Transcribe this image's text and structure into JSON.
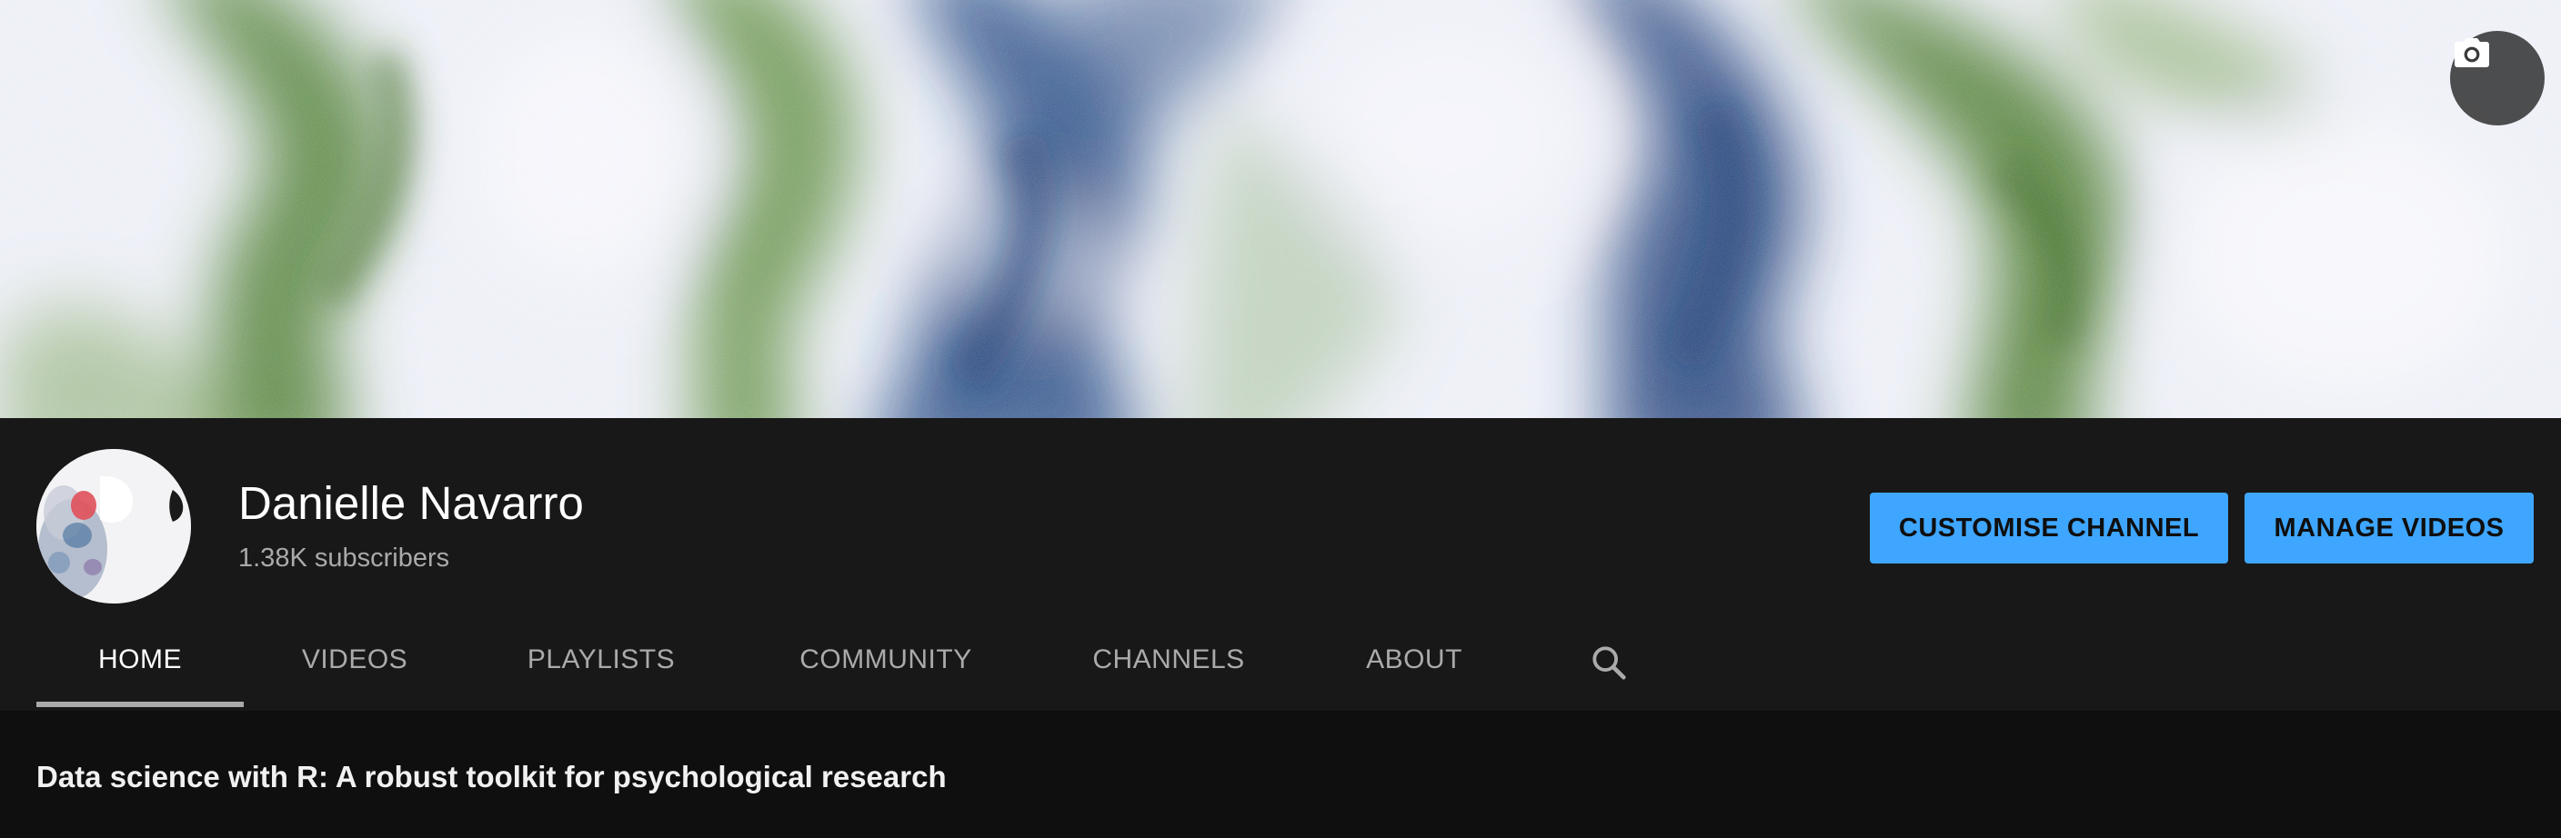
{
  "banner": {
    "camera_icon": "camera-icon"
  },
  "channel": {
    "name": "Danielle Navarro",
    "subscribers": "1.38K subscribers"
  },
  "actions": {
    "customise_label": "CUSTOMISE CHANNEL",
    "manage_label": "MANAGE VIDEOS"
  },
  "tabs": [
    {
      "label": "HOME",
      "active": true
    },
    {
      "label": "VIDEOS",
      "active": false
    },
    {
      "label": "PLAYLISTS",
      "active": false
    },
    {
      "label": "COMMUNITY",
      "active": false
    },
    {
      "label": "CHANNELS",
      "active": false
    },
    {
      "label": "ABOUT",
      "active": false
    }
  ],
  "search_icon": "search-icon",
  "content": {
    "section_title": "Data science with R: A robust toolkit for psychological research"
  },
  "colors": {
    "accent": "#3ea6ff",
    "header_bg": "#181818",
    "page_bg": "#0f0f0f",
    "banner_green": "#4a7a2e",
    "banner_blue": "#1f3f78"
  }
}
